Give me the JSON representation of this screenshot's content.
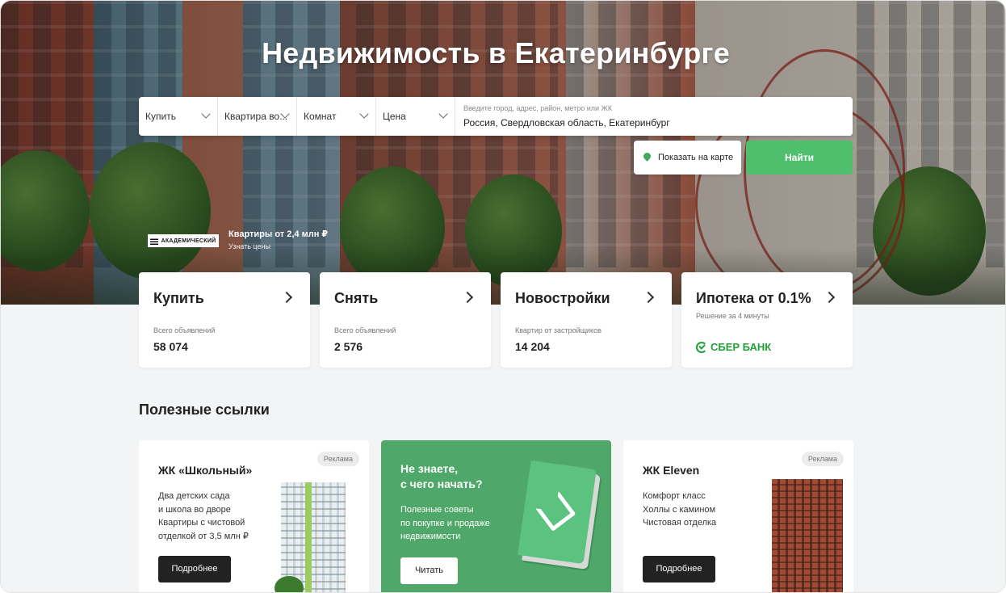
{
  "hero": {
    "title": "Недвижимость в Екатеринбурге",
    "search": {
      "deal_type": "Купить",
      "property_type": "Квартира во...",
      "rooms": "Комнат",
      "price": "Цена",
      "location_placeholder": "Введите город, адрес, район, метро или ЖК",
      "location_value": "Россия, Свердловская область, Екатеринбург"
    },
    "map_button": "Показать на карте",
    "find_button": "Найти",
    "promo": {
      "logo": "АКАДЕМИЧЕСКИЙ",
      "title": "Квартиры от 2,4 млн ₽",
      "link": "Узнать цены"
    }
  },
  "categories": [
    {
      "title": "Купить",
      "label": "Всего объявлений",
      "value": "58 074"
    },
    {
      "title": "Снять",
      "label": "Всего объявлений",
      "value": "2 576"
    },
    {
      "title": "Новостройки",
      "label": "Квартир от застройщиков",
      "value": "14 204"
    },
    {
      "title": "Ипотека от 0.1%",
      "label": "Решение за 4 минуты",
      "bank": "СБЕР БАНК"
    }
  ],
  "useful_links": {
    "title": "Полезные ссылки",
    "cards": [
      {
        "badge": "Реклама",
        "title": "ЖК «Школьный»",
        "lines": [
          "Два детских сада",
          "и школа во дворе",
          "Квартиры с чистовой",
          "отделкой от 3,5 млн ₽"
        ],
        "button": "Подробнее"
      },
      {
        "title_lines": [
          "Не знаете,",
          "с чего начать?"
        ],
        "lines": [
          "Полезные советы",
          "по покупке и продаже",
          "недвижимости"
        ],
        "button": "Читать"
      },
      {
        "badge": "Реклама",
        "title": "ЖК Eleven",
        "lines": [
          "Комфорт класс",
          "Холлы с камином",
          "Чистовая отделка"
        ],
        "button": "Подробнее"
      }
    ]
  },
  "colors": {
    "accent_green": "#4fbf6e",
    "card_green": "#4fa869",
    "sber_green": "#21a038"
  }
}
